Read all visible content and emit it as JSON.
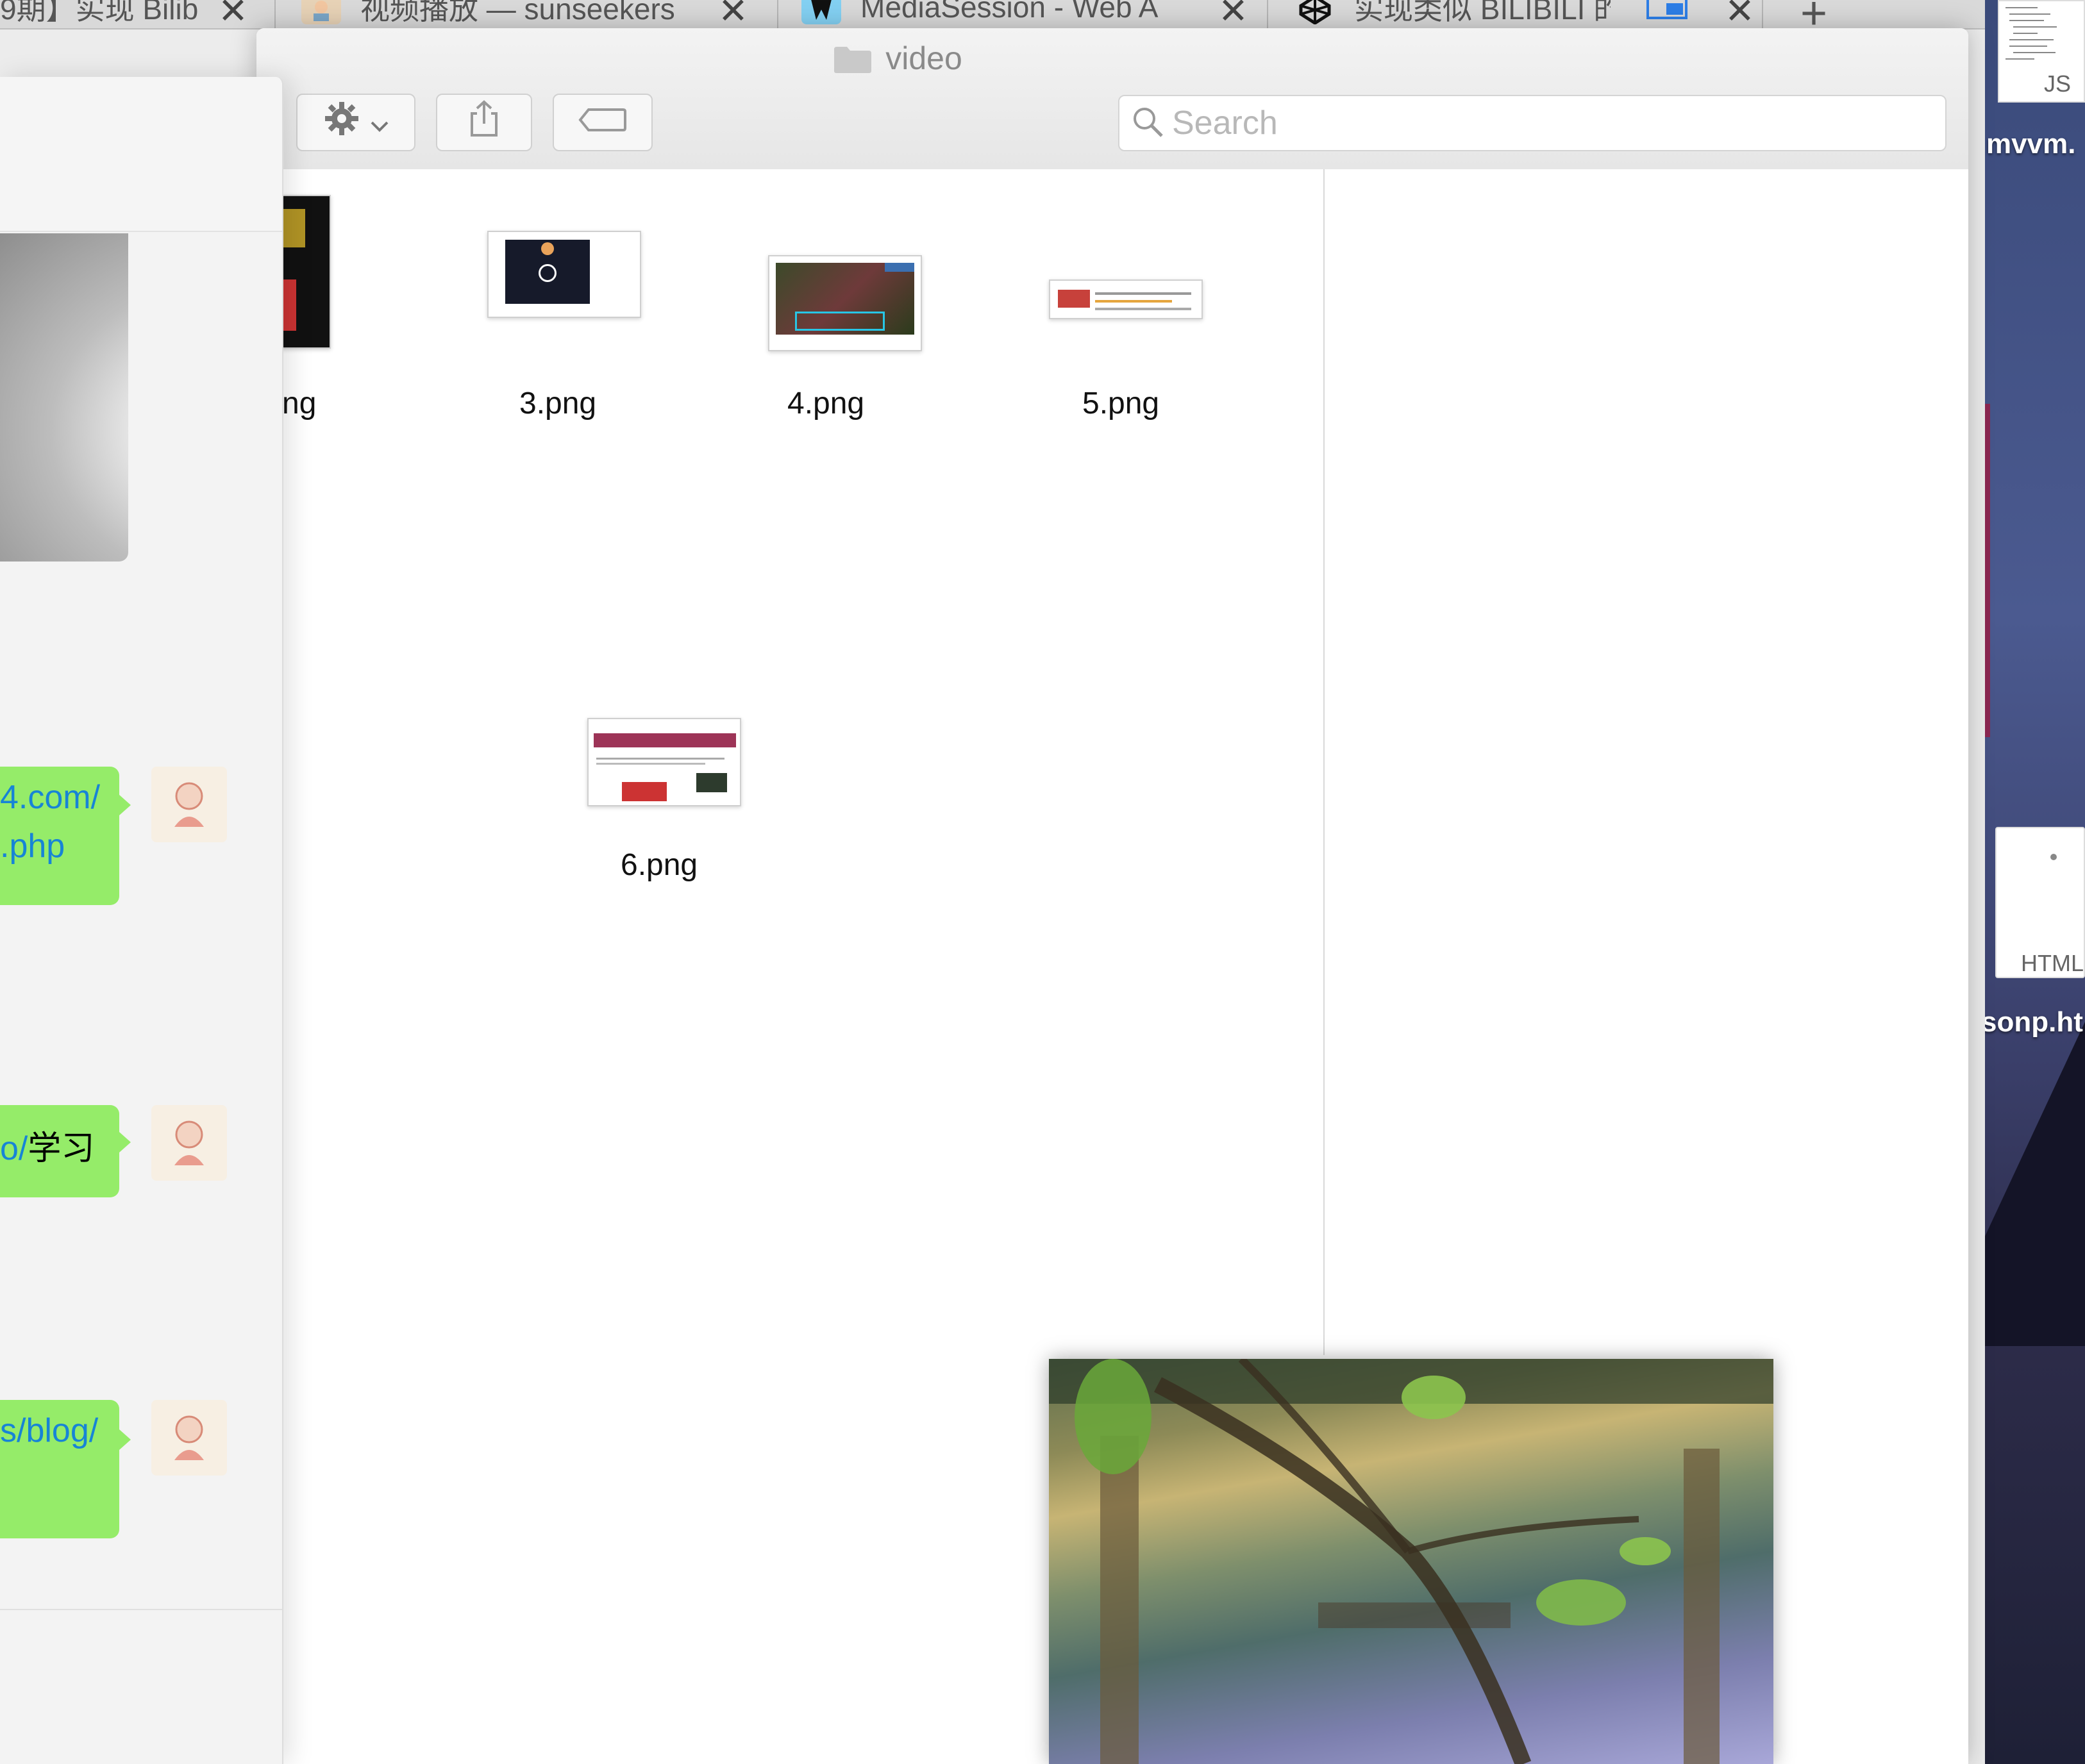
{
  "browser": {
    "tabs": [
      {
        "label": "9期】实现 Bilib",
        "favicon": "bilibili-icon"
      },
      {
        "label": "视频播放 — sunseekers",
        "favicon": "avatar-icon"
      },
      {
        "label": "MediaSession - Web A",
        "favicon": "mdn-icon"
      },
      {
        "label": "实现类似 BILIBILI 的",
        "favicon": "codepen-icon"
      }
    ],
    "new_tab_label": "+"
  },
  "finder": {
    "title": "video",
    "search_placeholder": "Search",
    "files": [
      {
        "name": "ng"
      },
      {
        "name": "3.png"
      },
      {
        "name": "4.png"
      },
      {
        "name": "5.png"
      },
      {
        "name": "6.png"
      }
    ]
  },
  "chat": {
    "messages": [
      {
        "line1": "4.com/",
        "line2": ".php"
      },
      {
        "link": "o/",
        "text": "学习"
      },
      {
        "line1": "s/blog/"
      }
    ]
  },
  "desktop": {
    "items": [
      {
        "label": "mvvm.",
        "type": "JS"
      },
      {
        "label": "sonp.ht",
        "type": "HTML"
      }
    ]
  },
  "colors": {
    "bubble": "#95ec69",
    "link": "#1784d6",
    "finder_bg": "#ffffff"
  }
}
